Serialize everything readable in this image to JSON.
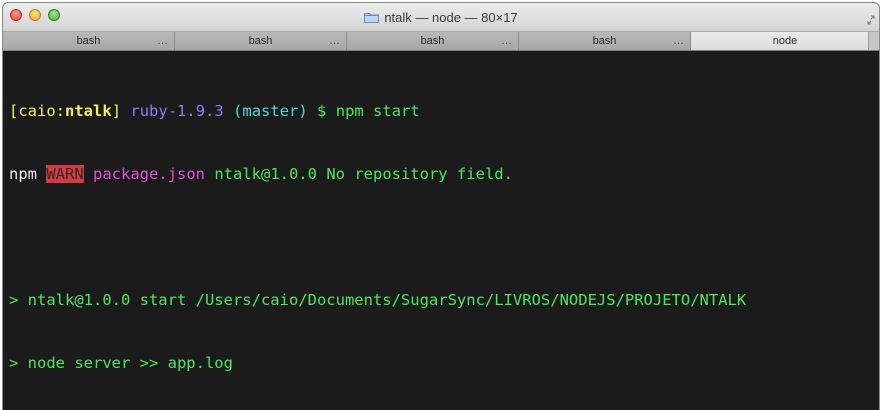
{
  "window": {
    "title": "ntalk — node — 80×17",
    "close_glyph": "×",
    "min_glyph": "−",
    "max_glyph": "+"
  },
  "tabs": [
    {
      "label": "bash",
      "overflow": "…"
    },
    {
      "label": "bash",
      "overflow": "…"
    },
    {
      "label": "bash",
      "overflow": "…"
    },
    {
      "label": "bash",
      "overflow": "…"
    },
    {
      "label": "node",
      "overflow": ""
    }
  ],
  "terminal": {
    "prompt": {
      "bracket_open": "[",
      "user": "caio",
      "sep": ":",
      "dir": "ntalk",
      "bracket_close": "]",
      "ruby": "ruby-1.9.3",
      "branch": "(master)",
      "symbol": "$",
      "command": "npm start"
    },
    "warn_line": {
      "npm": "npm",
      "level": "WARN",
      "file": "package.json",
      "message": "ntalk@1.0.0 No repository field."
    },
    "output": [
      "> ntalk@1.0.0 start /Users/caio/Documents/SugarSync/LIVROS/NODEJS/PROJETO/NTALK",
      "> node server >> app.log"
    ]
  },
  "colors": {
    "background": "#1b1b1b",
    "prompt_user": "#f4f15a",
    "ruby": "#8d7cf7",
    "branch": "#4fd5dc",
    "green": "#48e85d",
    "magenta": "#e052d8",
    "warn_bg": "#d53a40"
  },
  "icons": {
    "title_icon": "folder-icon",
    "resize": "fullscreen-icon"
  }
}
